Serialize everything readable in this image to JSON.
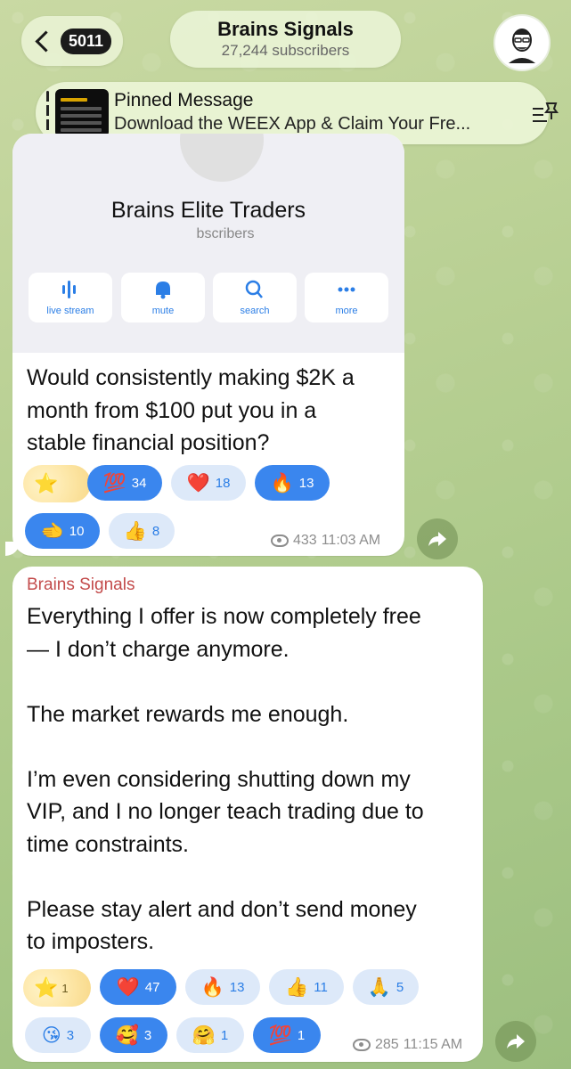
{
  "header": {
    "back_count": "5011",
    "channel_name": "Brains Signals",
    "subscribers": "27,244 subscribers"
  },
  "pinned": {
    "title": "Pinned Message",
    "text": "Download the WEEX App & Claim Your Fre..."
  },
  "message1": {
    "card": {
      "name": "Brains Elite Traders",
      "subscribers_partial": "bscribers",
      "buttons": [
        {
          "label": "live stream",
          "icon": "waveform-icon"
        },
        {
          "label": "mute",
          "icon": "bell-icon"
        },
        {
          "label": "search",
          "icon": "search-icon"
        },
        {
          "label": "more",
          "icon": "more-dots-icon"
        }
      ]
    },
    "text": "Would consistently making $2K a\nmonth from $100 put you in a\nstable financial position?",
    "reactions": [
      {
        "emoji": "⭐",
        "count": "",
        "style": "sparkle"
      },
      {
        "emoji": "💯",
        "count": "34",
        "style": "on"
      },
      {
        "emoji": "❤️",
        "count": "18",
        "style": "off"
      },
      {
        "emoji": "🔥",
        "count": "13",
        "style": "on"
      },
      {
        "emoji": "🫲",
        "count": "10",
        "style": "on"
      },
      {
        "emoji": "👍",
        "count": "8",
        "style": "off"
      }
    ],
    "views": "433",
    "time": "11:03 AM"
  },
  "message2": {
    "sender": "Brains Signals",
    "text": "Everything I offer is now completely free\n— I don’t charge anymore.\n\nThe market rewards me enough.\n\nI’m even considering shutting down my\nVIP, and I no longer teach trading due to\ntime constraints.\n\nPlease stay alert and don’t send money\nto imposters.",
    "reactions": [
      {
        "emoji": "⭐",
        "count": "1",
        "style": "sparkle"
      },
      {
        "emoji": "❤️",
        "count": "47",
        "style": "on"
      },
      {
        "emoji": "🔥",
        "count": "13",
        "style": "off"
      },
      {
        "emoji": "👍",
        "count": "11",
        "style": "off"
      },
      {
        "emoji": "🙏",
        "count": "5",
        "style": "off"
      },
      {
        "emoji": "😘",
        "count": "3",
        "style": "off"
      },
      {
        "emoji": "🥰",
        "count": "3",
        "style": "on"
      },
      {
        "emoji": "🤗",
        "count": "1",
        "style": "off"
      },
      {
        "emoji": "💯",
        "count": "1",
        "style": "on"
      }
    ],
    "views": "285",
    "time": "11:15 AM"
  },
  "colors": {
    "accent": "#3a86ee",
    "sender_name": "#c34b4b",
    "background": "#b7cf92"
  }
}
